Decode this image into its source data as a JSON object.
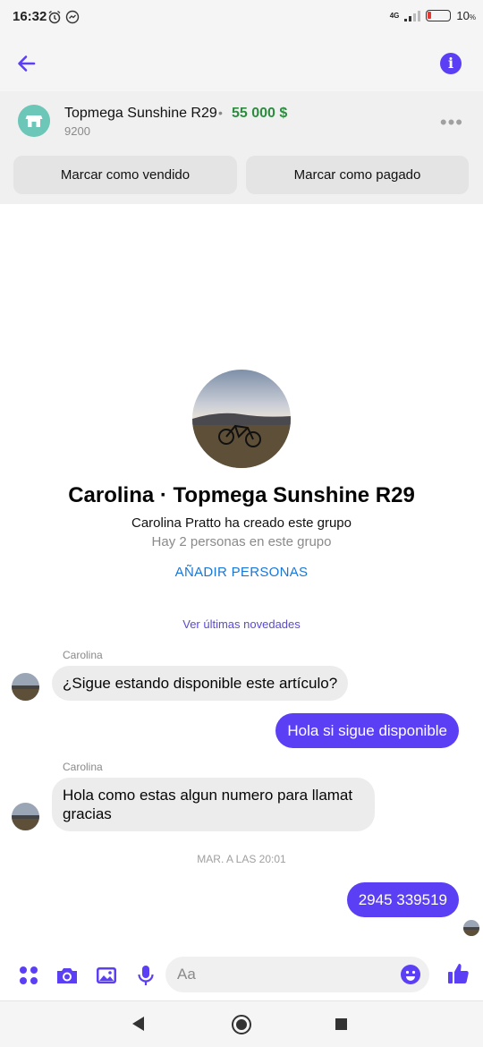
{
  "status_bar": {
    "time": "16:32",
    "network": "4G",
    "battery": "10",
    "battery_unit": "%",
    "icons": [
      "alarm-icon",
      "messenger-icon",
      "signal-icon",
      "battery-icon"
    ]
  },
  "header": {
    "back_icon": "arrow-left-icon",
    "info_icon": "info-icon",
    "info_glyph": "i"
  },
  "listing": {
    "title": "Topmega Sunshine R29",
    "separator": "•",
    "price": "55 000 $",
    "subtitle": "9200",
    "more_glyph": "•••",
    "buttons": {
      "mark_sold": "Marcar como vendido",
      "mark_paid": "Marcar como pagado"
    }
  },
  "group": {
    "title": "Carolina · Topmega Sunshine R29",
    "created_by": "Carolina Pratto ha creado este grupo",
    "member_count": "Hay 2 personas en este grupo",
    "add_people": "AÑADIR PERSONAS",
    "latest_news": "Ver últimas novedades"
  },
  "messages": [
    {
      "sender": "Carolina",
      "direction": "in",
      "text": "¿Sigue estando disponible este artículo?"
    },
    {
      "direction": "out",
      "text": "Hola si sigue disponible"
    },
    {
      "sender": "Carolina",
      "direction": "in",
      "text": "Hola como estas algun numero para llamat gracias"
    },
    {
      "timestamp": "MAR. A LAS 20:01"
    },
    {
      "direction": "out",
      "text": "2945 339519"
    }
  ],
  "composer": {
    "placeholder": "Aa",
    "icons": [
      "apps-icon",
      "camera-icon",
      "gallery-icon",
      "microphone-icon",
      "emoji-icon",
      "thumbs-up-icon"
    ]
  },
  "colors": {
    "accent": "#5b3ff5",
    "price_green": "#2c8d3f",
    "link_blue": "#1877d6",
    "incoming_bubble": "#ececec",
    "shop_teal": "#6cc7b8"
  }
}
